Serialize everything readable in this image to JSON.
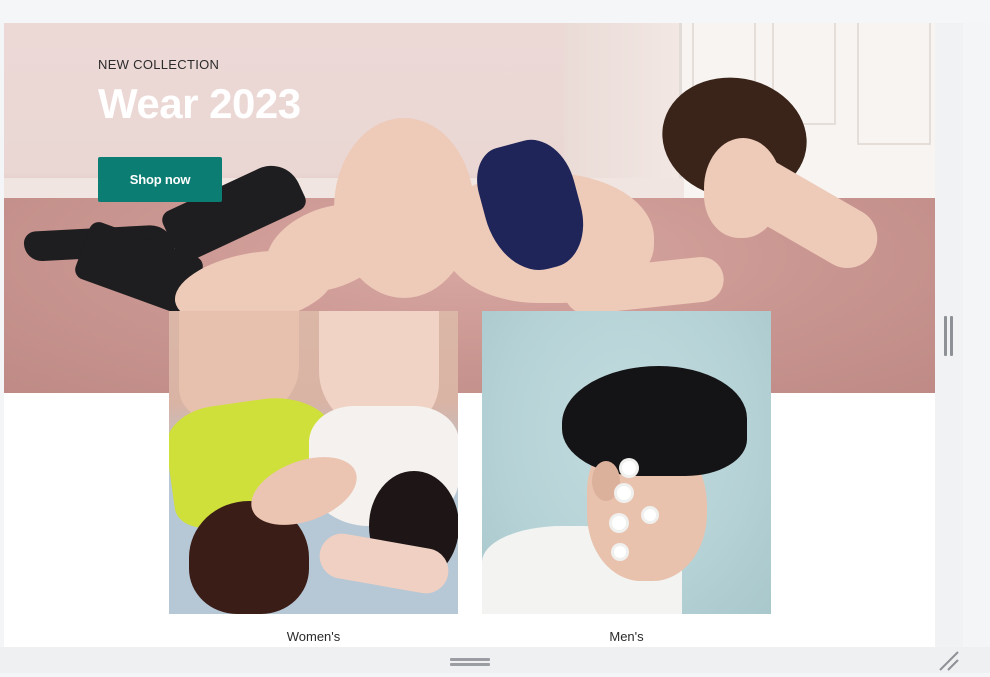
{
  "hero": {
    "eyebrow": "NEW COLLECTION",
    "title": "Wear 2023",
    "cta_label": "Shop now"
  },
  "categories": [
    {
      "label": "Women's",
      "image": "womens-photo"
    },
    {
      "label": "Men's",
      "image": "mens-photo"
    }
  ],
  "colors": {
    "accent": "#0c7d72",
    "hero_title": "#ffffff",
    "background": "#f4f5f6"
  },
  "icons": {
    "vertical_resize": "vertical-resize-handle-icon",
    "horizontal_resize": "horizontal-resize-handle-icon",
    "corner_resize": "corner-resize-grip-icon"
  }
}
